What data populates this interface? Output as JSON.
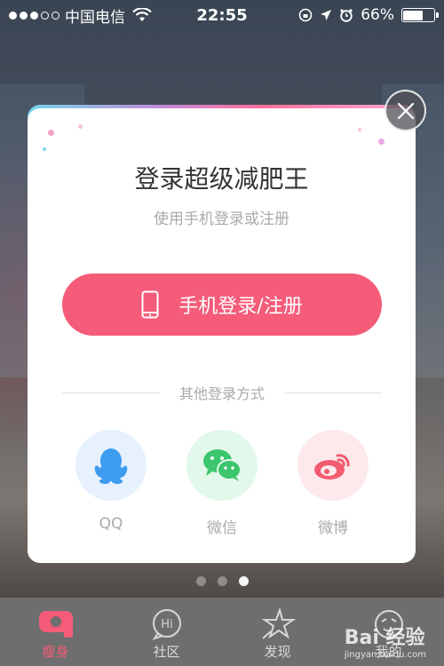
{
  "status_bar": {
    "carrier": "中国电信",
    "time": "22:55",
    "battery": "66%",
    "battery_level": 0.66
  },
  "modal": {
    "title": "登录超级减肥王",
    "subtitle": "使用手机登录或注册",
    "phone_button_label": "手机登录/注册",
    "divider_text": "其他登录方式",
    "social": [
      {
        "label": "QQ",
        "icon": "qq-penguin-icon",
        "bg": "#e6f1fd",
        "color": "#3d9bf0"
      },
      {
        "label": "微信",
        "icon": "wechat-icon",
        "bg": "#e2f8ea",
        "color": "#3cc66e"
      },
      {
        "label": "微博",
        "icon": "weibo-icon",
        "bg": "#fde8ec",
        "color": "#f25c6f"
      }
    ],
    "accent": "#f45c79"
  },
  "pager": {
    "count": 3,
    "active_index": 2
  },
  "tabbar": {
    "tabs": [
      {
        "label": "瘦身",
        "icon": "tape-measure-icon",
        "active": true
      },
      {
        "label": "社区",
        "icon": "hi-bubble-icon",
        "active": false
      },
      {
        "label": "发现",
        "icon": "star-icon",
        "active": false
      },
      {
        "label": "我的",
        "icon": "face-icon",
        "active": false
      }
    ]
  },
  "watermark": {
    "text": "Bai 经验",
    "sub": "jingyan.baidu.com"
  }
}
